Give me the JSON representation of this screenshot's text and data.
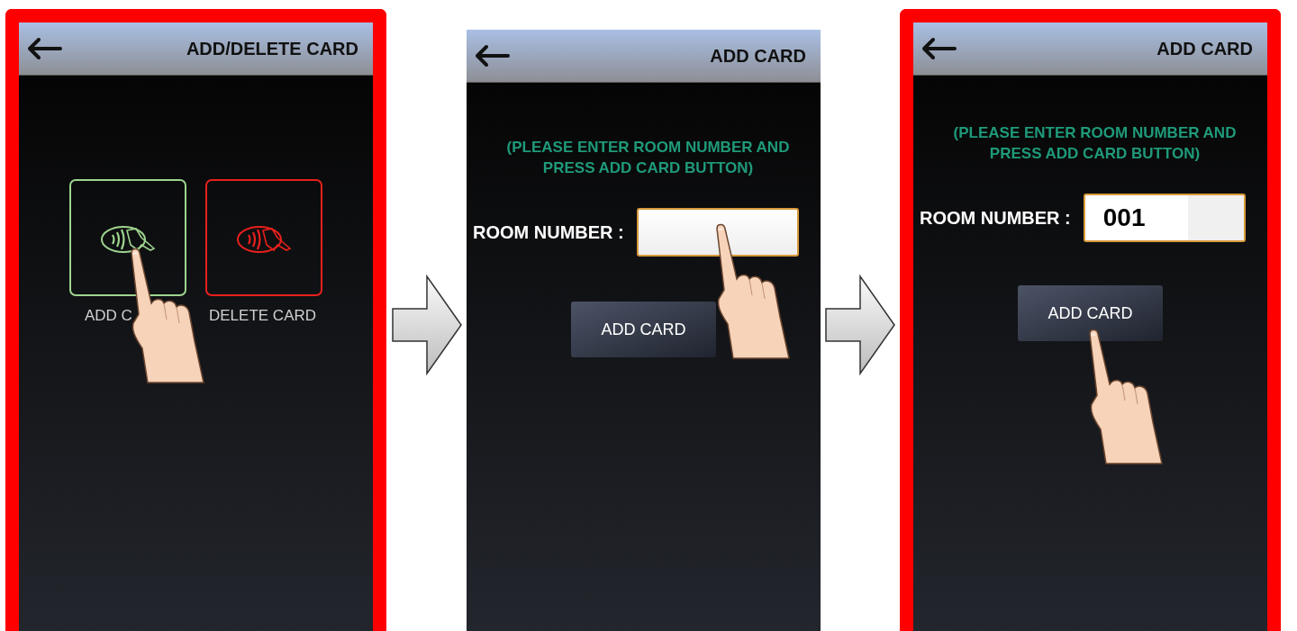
{
  "screens": [
    {
      "kind": "menu",
      "highlighted": true,
      "title": "ADD/DELETE CARD",
      "tiles": [
        {
          "label": "ADD C",
          "color": "#9fd48f"
        },
        {
          "label": "DELETE CARD",
          "color": "#e8201c"
        }
      ]
    },
    {
      "kind": "form",
      "highlighted": false,
      "title": "ADD CARD",
      "instructions": "(PLEASE ENTER ROOM NUMBER AND PRESS ADD CARD BUTTON)",
      "field_label": "ROOM NUMBER :",
      "button": "ADD CARD"
    },
    {
      "kind": "form",
      "highlighted": true,
      "title": "ADD CARD",
      "instructions": "(PLEASE ENTER ROOM NUMBER AND PRESS ADD CARD BUTTON)",
      "field_label": "ROOM NUMBER :",
      "value": "001",
      "button": "ADD CARD"
    }
  ]
}
